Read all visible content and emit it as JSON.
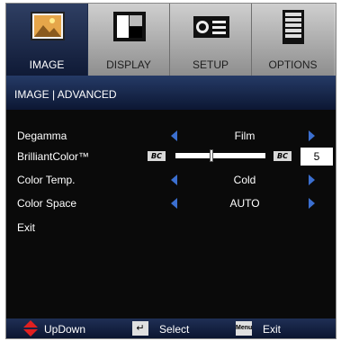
{
  "tabs": [
    {
      "label": "IMAGE",
      "icon": "image-icon",
      "active": true
    },
    {
      "label": "DISPLAY",
      "icon": "display-icon",
      "active": false
    },
    {
      "label": "SETUP",
      "icon": "setup-icon",
      "active": false
    },
    {
      "label": "OPTIONS",
      "icon": "options-icon",
      "active": false
    }
  ],
  "section": {
    "title": "IMAGE | ADVANCED"
  },
  "menu": {
    "degamma": {
      "label": "Degamma",
      "value": "Film"
    },
    "brilliant_color": {
      "label": "BrilliantColor™",
      "badge": "BC",
      "value": "5",
      "level_fraction": 0.4
    },
    "color_temp": {
      "label": "Color Temp.",
      "value": "Cold"
    },
    "color_space": {
      "label": "Color Space",
      "value": "AUTO"
    },
    "exit": {
      "label": "Exit"
    }
  },
  "footer": {
    "updown": "UpDown",
    "select": "Select",
    "menu_key": "Menu",
    "exit": "Exit"
  },
  "colors": {
    "accent": "#3b6fd0",
    "header": "#253a66",
    "background": "#0a0a0a",
    "updown_arrow": "#e02020"
  }
}
